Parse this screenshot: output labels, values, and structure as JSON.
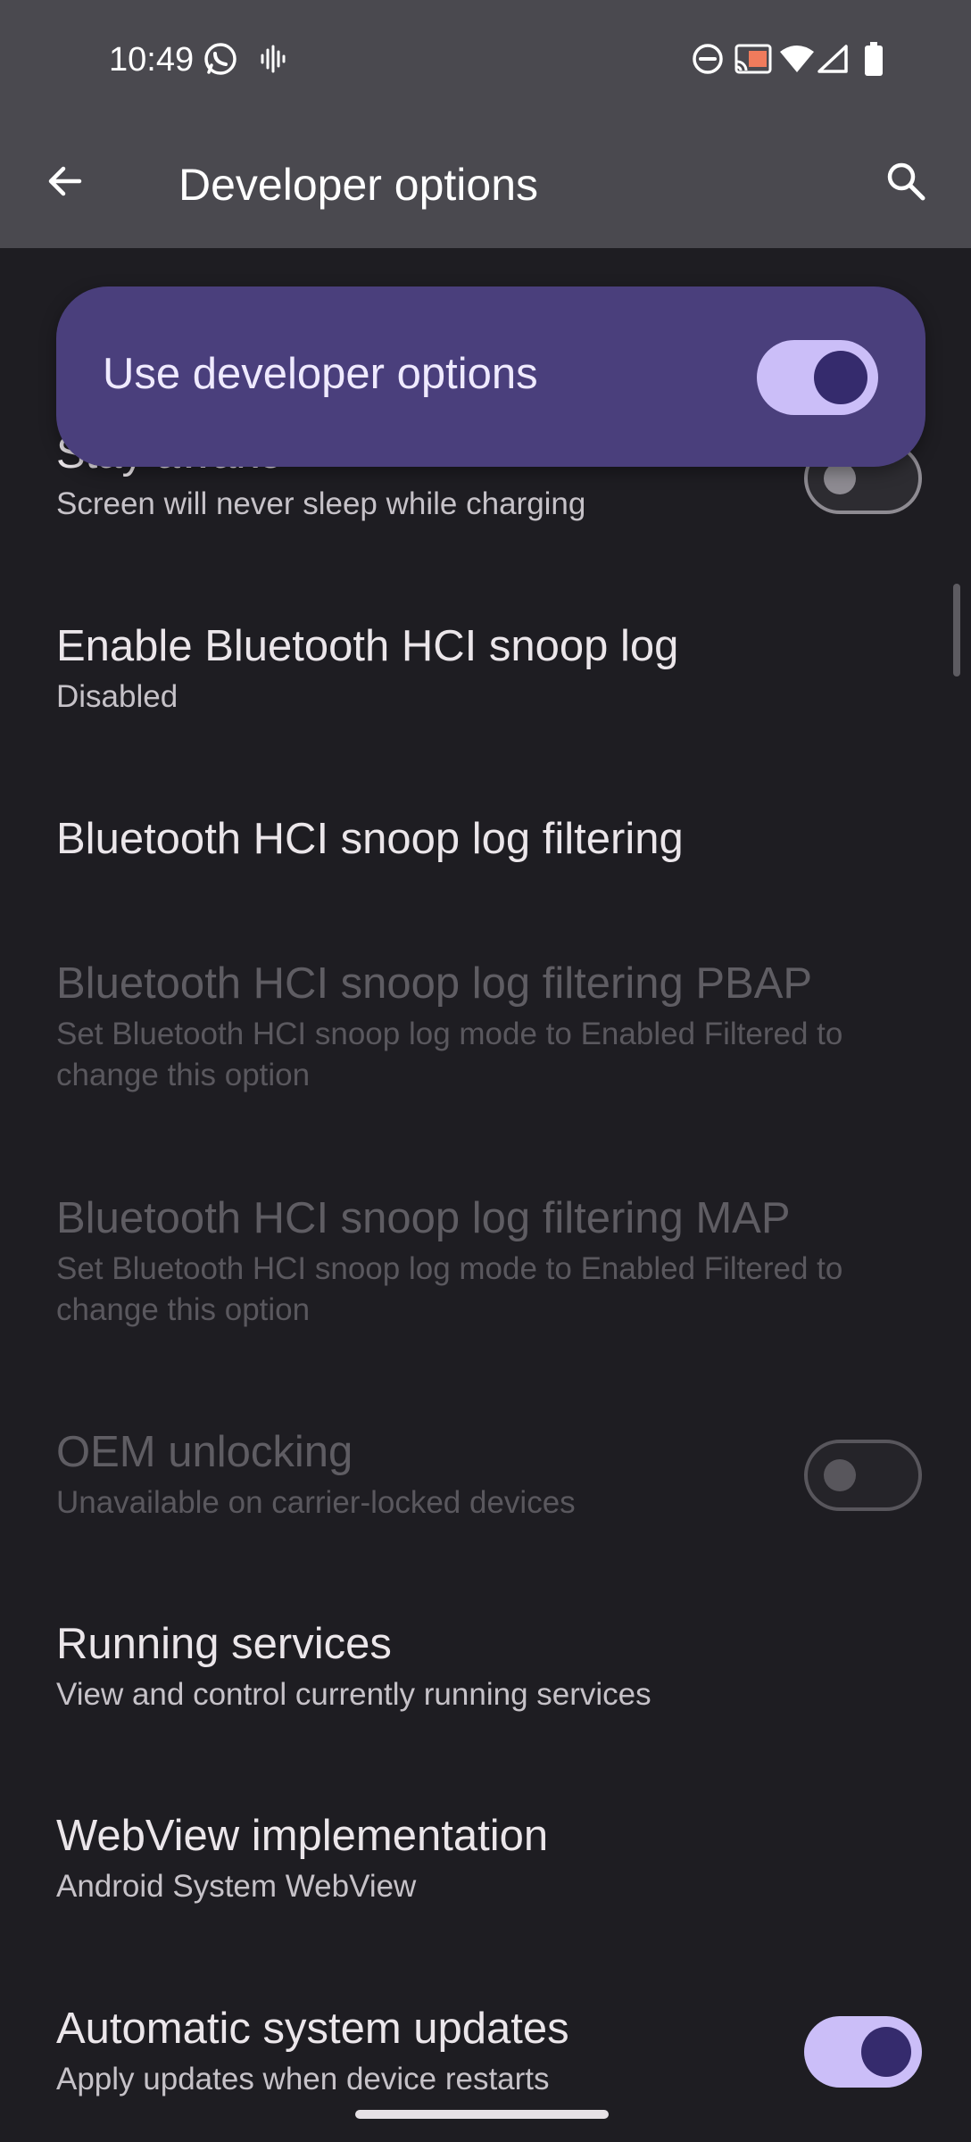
{
  "status_bar": {
    "time": "10:49",
    "icons": [
      "whatsapp-icon",
      "voice-icon",
      "dnd-icon",
      "cast-icon",
      "wifi-icon",
      "signal-icon",
      "battery-icon"
    ]
  },
  "app_bar": {
    "title": "Developer options",
    "back_icon": "arrow-back-icon",
    "search_icon": "search-icon"
  },
  "master_switch": {
    "label": "Use developer options",
    "state": "on"
  },
  "settings": [
    {
      "title": "Stay awake",
      "subtitle": "Screen will never sleep while charging",
      "toggle": "off",
      "enabled": true
    },
    {
      "title": "Enable Bluetooth HCI snoop log",
      "subtitle": "Disabled",
      "enabled": true
    },
    {
      "title": "Bluetooth HCI snoop log filtering",
      "enabled": true
    },
    {
      "title": "Bluetooth HCI snoop log filtering PBAP",
      "subtitle": "Set Bluetooth HCI snoop log mode to Enabled Filtered to change this option",
      "enabled": false
    },
    {
      "title": "Bluetooth HCI snoop log filtering MAP",
      "subtitle": "Set Bluetooth HCI snoop log mode to Enabled Filtered to change this option",
      "enabled": false
    },
    {
      "title": "OEM unlocking",
      "subtitle": "Unavailable on carrier-locked devices",
      "toggle": "off",
      "enabled": false
    },
    {
      "title": "Running services",
      "subtitle": "View and control currently running services",
      "enabled": true
    },
    {
      "title": "WebView implementation",
      "subtitle": "Android System WebView",
      "enabled": true
    },
    {
      "title": "Automatic system updates",
      "subtitle": "Apply updates when device restarts",
      "toggle": "on",
      "enabled": true
    }
  ],
  "colors": {
    "background": "#1e1d22",
    "app_bar": "#4a494f",
    "master_card": "#4a3f7c",
    "toggle_on_track": "#cbbef8",
    "toggle_on_knob": "#352b6d"
  }
}
